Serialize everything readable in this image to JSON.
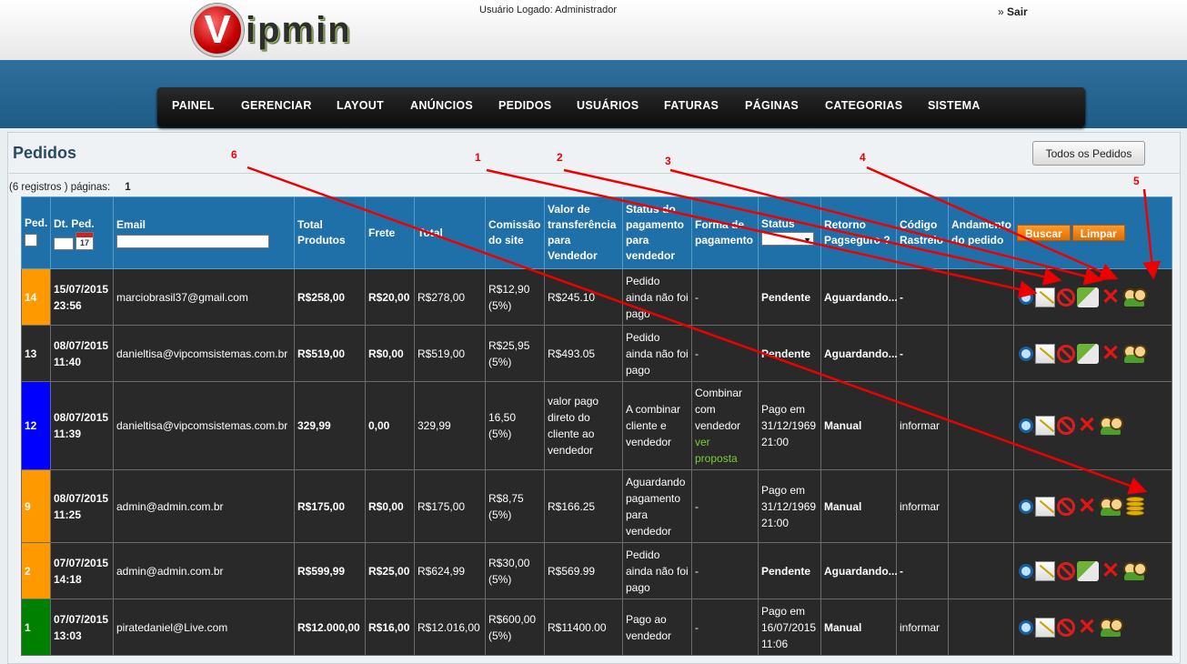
{
  "header": {
    "logo_letter": "V",
    "logo_text": "ipmin",
    "logged_user": "Usuário Logado: Administrador",
    "logout_prefix": "»",
    "logout_label": "Sair"
  },
  "nav": [
    "PAINEL",
    "GERENCIAR",
    "LAYOUT",
    "ANÚNCIOS",
    "PEDIDOS",
    "USUÁRIOS",
    "FATURAS",
    "PÁGINAS",
    "CATEGORIAS",
    "SISTEMA"
  ],
  "page": {
    "title": "Pedidos",
    "all_orders_button": "Todos os Pedidos",
    "records_text": "(6 registros ) páginas:",
    "page_number": "1"
  },
  "table": {
    "headers": {
      "ped": "Ped.",
      "dt_ped": "Dt. Ped.",
      "email": "Email",
      "total_produtos": "Total Produtos",
      "frete": "Frete",
      "total": "Total",
      "comissao": "Comissão do site",
      "valor_transf": "Valor de transferência para Vendedor",
      "status_pag": "Status do pagamento para vendedor",
      "forma_pag": "Forma de pagamento",
      "status": "Status",
      "retorno": "Retorno Pagseguro",
      "retorno_help": "?",
      "codigo": "Código Rastreio",
      "andamento": "Andamento do pedido"
    },
    "calendar_day": "17",
    "buttons": {
      "search": "Buscar",
      "clear": "Limpar"
    },
    "rows": [
      {
        "stripe_color": "#ff9900",
        "id": "14",
        "date": "15/07/2015",
        "time": "23:56",
        "email": "marciobrasil37@gmail.com",
        "total_produtos": "R$258,00",
        "frete": "R$20,00",
        "total": "R$278,00",
        "comissao": "R$12,90",
        "comissao_pct": "(5%)",
        "valor_transf": "R$245.10",
        "status_pag": "Pedido ainda não foi pago",
        "forma_pag": "-",
        "forma_pag_link": "",
        "status": "Pendente",
        "status_time": "",
        "retorno": "Aguardando...",
        "codigo": "-",
        "icons": [
          "zoom-icon",
          "note-icon",
          "block-icon",
          "payment-icon",
          "delete-icon",
          "users-icon"
        ]
      },
      {
        "stripe_color": "#2a2a2a",
        "id": "13",
        "date": "08/07/2015",
        "time": "11:40",
        "email": "danieltisa@vipcomsistemas.com.br",
        "total_produtos": "R$519,00",
        "frete": "R$0,00",
        "total": "R$519,00",
        "comissao": "R$25,95",
        "comissao_pct": "(5%)",
        "valor_transf": "R$493.05",
        "status_pag": "Pedido ainda não foi pago",
        "forma_pag": "-",
        "forma_pag_link": "",
        "status": "Pendente",
        "status_time": "",
        "retorno": "Aguardando...",
        "codigo": "-",
        "icons": [
          "zoom-icon",
          "note-icon",
          "block-icon",
          "payment-icon",
          "delete-icon",
          "users-icon"
        ]
      },
      {
        "stripe_color": "#0000ff",
        "id": "12",
        "date": "08/07/2015",
        "time": "11:39",
        "email": "danieltisa@vipcomsistemas.com.br",
        "total_produtos": "329,99",
        "frete": "0,00",
        "total": "329,99",
        "comissao": "16,50",
        "comissao_pct": "(5%)",
        "valor_transf": "valor pago direto do cliente ao vendedor",
        "status_pag": "A combinar cliente e vendedor",
        "forma_pag": "Combinar com vendedor",
        "forma_pag_link": "ver proposta",
        "status": "Pago em 31/12/1969",
        "status_time": "21:00",
        "retorno": "Manual",
        "codigo": "informar",
        "icons": [
          "zoom-icon",
          "note-icon",
          "block-icon",
          "delete-icon",
          "users-icon"
        ]
      },
      {
        "stripe_color": "#ff9900",
        "id": "9",
        "date": "08/07/2015",
        "time": "11:25",
        "email": "admin@admin.com.br",
        "total_produtos": "R$175,00",
        "frete": "R$0,00",
        "total": "R$175,00",
        "comissao": "R$8,75",
        "comissao_pct": "(5%)",
        "valor_transf": "R$166.25",
        "status_pag": "Aguardando pagamento para vendedor",
        "forma_pag": "-",
        "forma_pag_link": "",
        "status": "Pago em 31/12/1969",
        "status_time": "21:00",
        "retorno": "Manual",
        "codigo": "informar",
        "icons": [
          "zoom-icon",
          "note-icon",
          "block-icon",
          "delete-icon",
          "users-icon",
          "coins-icon"
        ]
      },
      {
        "stripe_color": "#ff9900",
        "id": "2",
        "date": "07/07/2015",
        "time": "14:18",
        "email": "admin@admin.com.br",
        "total_produtos": "R$599,99",
        "frete": "R$25,00",
        "total": "R$624,99",
        "comissao": "R$30,00",
        "comissao_pct": "(5%)",
        "valor_transf": "R$569.99",
        "status_pag": "Pedido ainda não foi pago",
        "forma_pag": "-",
        "forma_pag_link": "",
        "status": "Pendente",
        "status_time": "",
        "retorno": "Aguardando...",
        "codigo": "-",
        "icons": [
          "zoom-icon",
          "note-icon",
          "block-icon",
          "payment-icon",
          "delete-icon",
          "users-icon"
        ]
      },
      {
        "stripe_color": "#008000",
        "id": "1",
        "date": "07/07/2015",
        "time": "13:03",
        "email": "piratedaniel@Live.com",
        "total_produtos": "R$12.000,00",
        "frete": "R$16,00",
        "total": "R$12.016,00",
        "comissao": "R$600,00",
        "comissao_pct": "(5%)",
        "valor_transf": "R$11400.00",
        "status_pag": "Pago ao vendedor",
        "forma_pag": "-",
        "forma_pag_link": "",
        "status": "Pago em 16/07/2015",
        "status_time": "11:06",
        "retorno": "Manual",
        "codigo": "informar",
        "icons": [
          "zoom-icon",
          "note-icon",
          "block-icon",
          "delete-icon",
          "users-icon"
        ]
      }
    ]
  },
  "annotations": [
    "1",
    "2",
    "3",
    "4",
    "5",
    "6"
  ],
  "colors": {
    "header_band": "#2f6f9b",
    "table_header": "#1f70a8",
    "row_bg": "#292929",
    "email_green": "#9ccc47",
    "value_yellow": "#ffff00",
    "orange": "#ff9a2a",
    "arrow_red": "#ee0000"
  }
}
